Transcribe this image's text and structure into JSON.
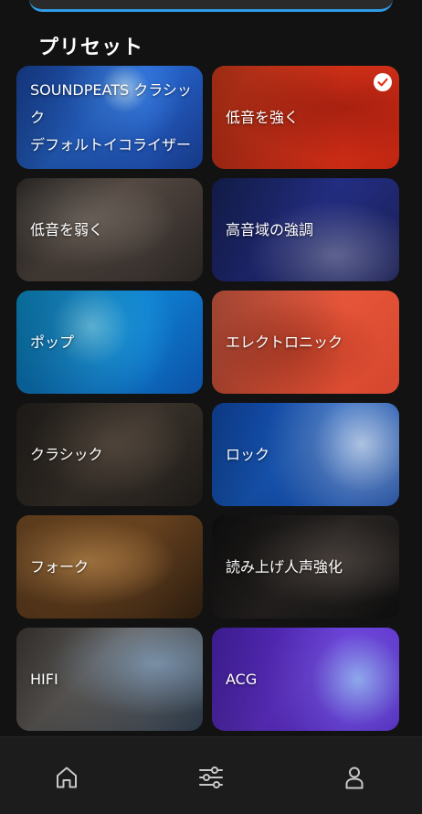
{
  "section": {
    "title": "プリセット"
  },
  "presets": [
    {
      "label": "SOUNDPEATS クラシック\nデフォルトイコライザー",
      "selected": false
    },
    {
      "label": "低音を強く",
      "selected": true
    },
    {
      "label": "低音を弱く",
      "selected": false
    },
    {
      "label": "高音域の強調",
      "selected": false
    },
    {
      "label": "ポップ",
      "selected": false
    },
    {
      "label": "エレクトロニック",
      "selected": false
    },
    {
      "label": "クラシック",
      "selected": false
    },
    {
      "label": "ロック",
      "selected": false
    },
    {
      "label": "フォーク",
      "selected": false
    },
    {
      "label": "読み上げ人声強化",
      "selected": false
    },
    {
      "label": "HIFI",
      "selected": false
    },
    {
      "label": "ACG",
      "selected": false
    }
  ],
  "icons": {
    "selected": "checkmark-icon",
    "nav_home": "home-icon",
    "nav_equalizer": "sliders-icon",
    "nav_profile": "user-icon"
  },
  "colors": {
    "background": "#121212",
    "accent": "#2f9ce8",
    "nav_icon": "#c8c8c8"
  }
}
